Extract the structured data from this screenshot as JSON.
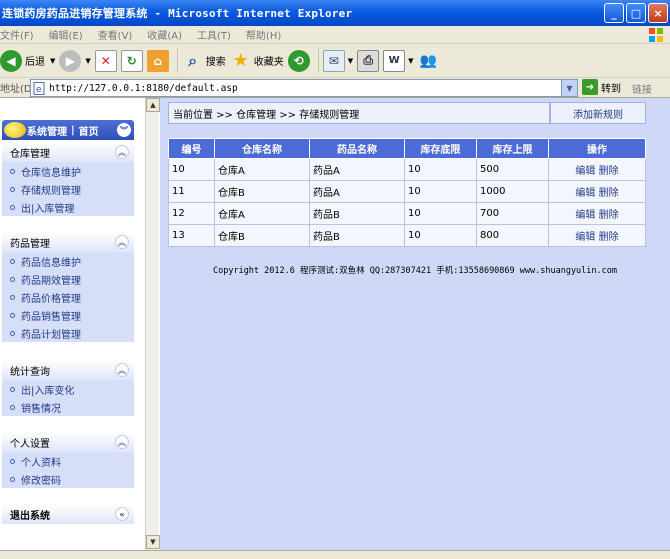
{
  "window": {
    "title": "连锁药房药品进销存管理系统 - Microsoft Internet Explorer",
    "btn_min": "_",
    "btn_max": "□",
    "btn_close": "×"
  },
  "menu": [
    "文件(F)",
    "编辑(E)",
    "查看(V)",
    "收藏(A)",
    "工具(T)",
    "帮助(H)"
  ],
  "toolbar": {
    "back": "后退",
    "search": "搜索",
    "favorites": "收藏夹"
  },
  "address": {
    "label": "地址(D)",
    "url": "http://127.0.0.1:8180/default.asp",
    "go": "转到",
    "links": "链接"
  },
  "sidebar": {
    "header_left": "系统管理",
    "header_sep": "|",
    "header_right": "首页",
    "groups": [
      {
        "title": "仓库管理",
        "items": [
          "仓库信息维护",
          "存储规则管理",
          "出|入库管理"
        ]
      },
      {
        "title": "药品管理",
        "items": [
          "药品信息维护",
          "药品期效管理",
          "药品价格管理",
          "药品销售管理",
          "药品计划管理"
        ]
      },
      {
        "title": "统计查询",
        "items": [
          "出|入库变化",
          "销售情况"
        ]
      },
      {
        "title": "个人设置",
        "items": [
          "个人资料",
          "修改密码"
        ]
      },
      {
        "title": "退出系统",
        "items": []
      }
    ]
  },
  "main": {
    "breadcrumb": "当前位置 >> 仓库管理 >> 存储规则管理",
    "add_new": "添加新规则",
    "columns": [
      "编号",
      "仓库名称",
      "药品名称",
      "库存底限",
      "库存上限",
      "操作"
    ],
    "rows": [
      [
        "10",
        "仓库A",
        "药品A",
        "10",
        "500"
      ],
      [
        "11",
        "仓库B",
        "药品A",
        "10",
        "1000"
      ],
      [
        "12",
        "仓库A",
        "药品B",
        "10",
        "700"
      ],
      [
        "13",
        "仓库B",
        "药品B",
        "10",
        "800"
      ]
    ],
    "op_edit": "编辑",
    "op_delete": "删除",
    "footer": "Copyright 2012.6 程序测试:双鱼林 QQ:287307421 手机:13558690869 www.shuangyulin.com"
  }
}
